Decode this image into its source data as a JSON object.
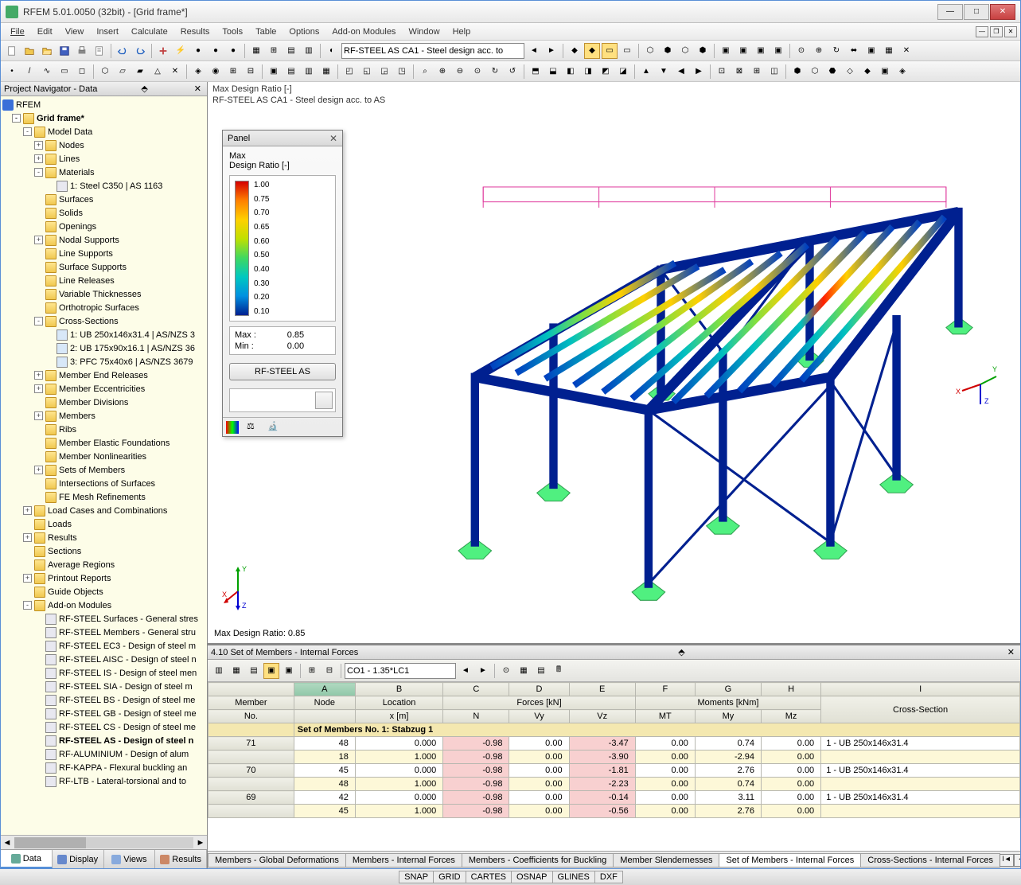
{
  "app": {
    "title": "RFEM 5.01.0050 (32bit) - [Grid frame*]"
  },
  "menu": [
    "File",
    "Edit",
    "View",
    "Insert",
    "Calculate",
    "Results",
    "Tools",
    "Table",
    "Options",
    "Add-on Modules",
    "Window",
    "Help"
  ],
  "toolbar2_combo": "RF-STEEL AS CA1 - Steel design acc. to",
  "nav": {
    "header": "Project Navigator - Data",
    "root": "RFEM",
    "model": "Grid frame*",
    "model_data": "Model Data",
    "items": [
      "Nodes",
      "Lines",
      "Materials",
      "Surfaces",
      "Solids",
      "Openings",
      "Nodal Supports",
      "Line Supports",
      "Surface Supports",
      "Line Releases",
      "Variable Thicknesses",
      "Orthotropic Surfaces",
      "Cross-Sections",
      "Member End Releases",
      "Member Eccentricities",
      "Member Divisions",
      "Members",
      "Ribs",
      "Member Elastic Foundations",
      "Member Nonlinearities",
      "Sets of Members",
      "Intersections of Surfaces",
      "FE Mesh Refinements"
    ],
    "material_child": "1: Steel C350 | AS 1163",
    "cs": [
      "1: UB 250x146x31.4 | AS/NZS 3",
      "2: UB 175x90x16.1 | AS/NZS 36",
      "3: PFC 75x40x6 | AS/NZS 3679"
    ],
    "after_model": [
      "Load Cases and Combinations",
      "Loads",
      "Results",
      "Sections",
      "Average Regions",
      "Printout Reports",
      "Guide Objects",
      "Add-on Modules"
    ],
    "addons": [
      "RF-STEEL Surfaces - General stres",
      "RF-STEEL Members - General stru",
      "RF-STEEL EC3 - Design of steel m",
      "RF-STEEL AISC - Design of steel n",
      "RF-STEEL IS - Design of steel men",
      "RF-STEEL SIA - Design of steel m",
      "RF-STEEL BS - Design of steel me",
      "RF-STEEL GB - Design of steel me",
      "RF-STEEL CS - Design of steel me",
      "RF-STEEL AS - Design of steel n",
      "RF-ALUMINIUM - Design of alum",
      "RF-KAPPA - Flexural buckling an",
      "RF-LTB - Lateral-torsional and to"
    ],
    "tabs": [
      "Data",
      "Display",
      "Views",
      "Results"
    ]
  },
  "canvas": {
    "line1": "Max Design Ratio [-]",
    "line2": "RF-STEEL AS CA1 - Steel design acc. to AS",
    "bottom": "Max Design Ratio: 0.85"
  },
  "panel": {
    "title": "Panel",
    "sub1": "Max",
    "sub2": "Design Ratio [-]",
    "legend": [
      "1.00",
      "0.75",
      "0.70",
      "0.65",
      "0.60",
      "0.50",
      "0.40",
      "0.30",
      "0.20",
      "0.10"
    ],
    "max_lbl": "Max  :",
    "max_val": "0.85",
    "min_lbl": "Min  :",
    "min_val": "0.00",
    "button": "RF-STEEL AS"
  },
  "table": {
    "header": "4.10 Set of Members - Internal Forces",
    "combo": "CO1 - 1.35*LC1",
    "cols_letter": [
      "A",
      "B",
      "C",
      "D",
      "E",
      "F",
      "G",
      "H",
      "I"
    ],
    "group_forces": "Forces [kN]",
    "group_moments": "Moments [kNm]",
    "h_member": "Member",
    "h_no": "No.",
    "h_node": "Node",
    "h_loc": "Location",
    "h_x": "x [m]",
    "h_n": "N",
    "h_vy": "Vy",
    "h_vz": "Vz",
    "h_mt": "MT",
    "h_my": "My",
    "h_mz": "Mz",
    "h_cs": "Cross-Section",
    "grouprow": "Set of Members No. 1: Stabzug 1",
    "rows": [
      {
        "m": "71",
        "n": "48",
        "x": "0.000",
        "N": "-0.98",
        "Vy": "0.00",
        "Vz": "-3.47",
        "Mt": "0.00",
        "My": "0.74",
        "Mz": "0.00",
        "cs": "1 - UB 250x146x31.4"
      },
      {
        "m": "",
        "n": "18",
        "x": "1.000",
        "N": "-0.98",
        "Vy": "0.00",
        "Vz": "-3.90",
        "Mt": "0.00",
        "My": "-2.94",
        "Mz": "0.00",
        "cs": ""
      },
      {
        "m": "70",
        "n": "45",
        "x": "0.000",
        "N": "-0.98",
        "Vy": "0.00",
        "Vz": "-1.81",
        "Mt": "0.00",
        "My": "2.76",
        "Mz": "0.00",
        "cs": "1 - UB 250x146x31.4"
      },
      {
        "m": "",
        "n": "48",
        "x": "1.000",
        "N": "-0.98",
        "Vy": "0.00",
        "Vz": "-2.23",
        "Mt": "0.00",
        "My": "0.74",
        "Mz": "0.00",
        "cs": ""
      },
      {
        "m": "69",
        "n": "42",
        "x": "0.000",
        "N": "-0.98",
        "Vy": "0.00",
        "Vz": "-0.14",
        "Mt": "0.00",
        "My": "3.11",
        "Mz": "0.00",
        "cs": "1 - UB 250x146x31.4"
      },
      {
        "m": "",
        "n": "45",
        "x": "1.000",
        "N": "-0.98",
        "Vy": "0.00",
        "Vz": "-0.56",
        "Mt": "0.00",
        "My": "2.76",
        "Mz": "0.00",
        "cs": ""
      }
    ],
    "tabs": [
      "Members - Global Deformations",
      "Members - Internal Forces",
      "Members - Coefficients for Buckling",
      "Member Slendernesses",
      "Set of Members - Internal Forces",
      "Cross-Sections - Internal Forces"
    ]
  },
  "status": [
    "SNAP",
    "GRID",
    "CARTES",
    "OSNAP",
    "GLINES",
    "DXF"
  ]
}
